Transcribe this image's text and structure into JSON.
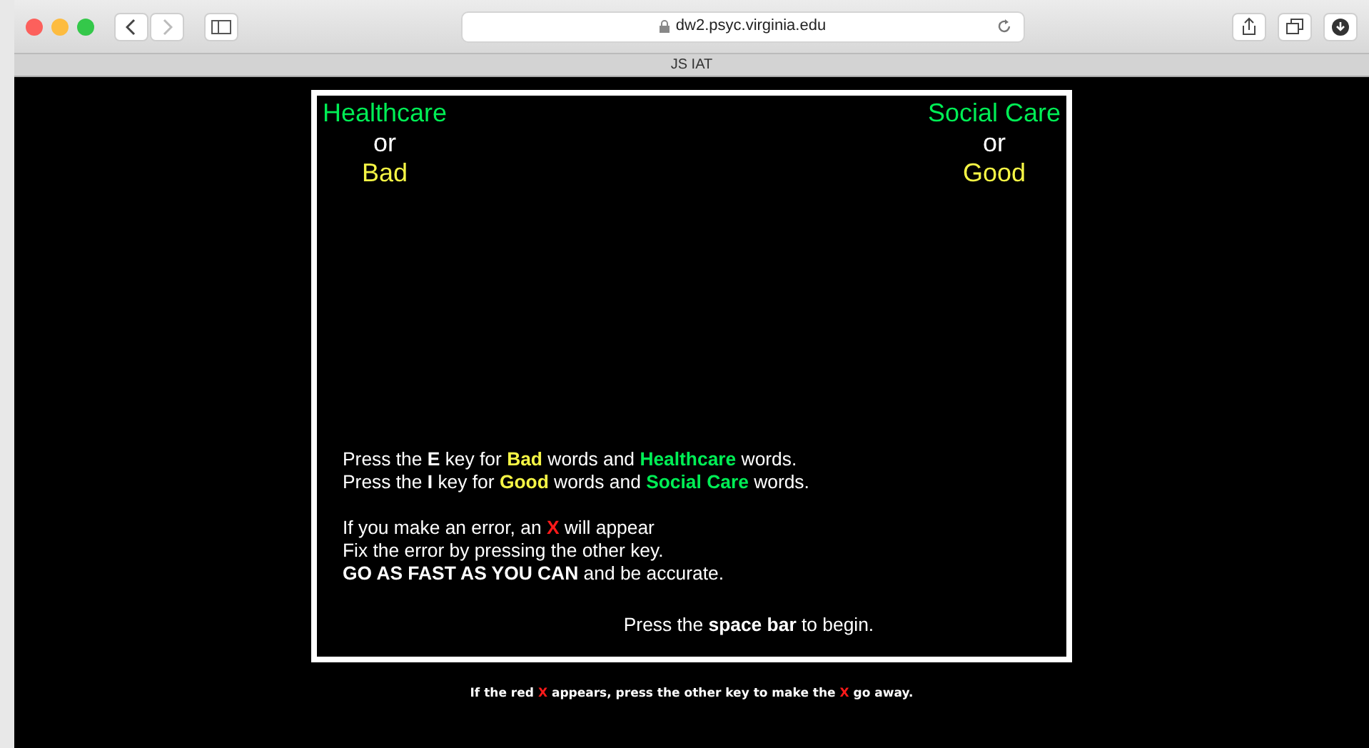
{
  "browser": {
    "url": "dw2.psyc.virginia.edu",
    "tab_title": "JS IAT"
  },
  "left_labels": [
    {
      "text": "Healthcare",
      "kind": "category"
    },
    {
      "text": "or",
      "kind": "connector"
    },
    {
      "text": "Bad",
      "kind": "attribute"
    }
  ],
  "right_labels": [
    {
      "text": "Social Care",
      "kind": "category"
    },
    {
      "text": "or",
      "kind": "connector"
    },
    {
      "text": "Good",
      "kind": "attribute"
    }
  ],
  "instruction_paragraphs": [
    [
      [
        {
          "text": "Press the ",
          "kind": "plain"
        },
        {
          "text": "E",
          "kind": "bold"
        },
        {
          "text": " key for ",
          "kind": "plain"
        },
        {
          "text": "Bad",
          "kind": "attribute"
        },
        {
          "text": " words and ",
          "kind": "plain"
        },
        {
          "text": "Healthcare",
          "kind": "category"
        },
        {
          "text": " words.",
          "kind": "plain"
        }
      ],
      [
        {
          "text": "Press the ",
          "kind": "plain"
        },
        {
          "text": "I",
          "kind": "bold"
        },
        {
          "text": " key for ",
          "kind": "plain"
        },
        {
          "text": "Good",
          "kind": "attribute"
        },
        {
          "text": " words and ",
          "kind": "plain"
        },
        {
          "text": "Social Care",
          "kind": "category"
        },
        {
          "text": " words.",
          "kind": "plain"
        }
      ]
    ],
    [
      [
        {
          "text": "If you make an error, an ",
          "kind": "plain"
        },
        {
          "text": "X",
          "kind": "error"
        },
        {
          "text": " will appear",
          "kind": "plain"
        }
      ],
      [
        {
          "text": "Fix the error by pressing the other key.",
          "kind": "plain"
        }
      ],
      [
        {
          "text": "GO AS FAST AS YOU CAN",
          "kind": "bold"
        },
        {
          "text": " and be accurate.",
          "kind": "plain"
        }
      ]
    ]
  ],
  "start_prompt": [
    {
      "text": "Press the ",
      "kind": "plain"
    },
    {
      "text": "space bar",
      "kind": "bold"
    },
    {
      "text": " to begin.",
      "kind": "plain"
    }
  ],
  "footer": [
    {
      "text": "If the red ",
      "kind": "plain"
    },
    {
      "text": "X",
      "kind": "error"
    },
    {
      "text": " appears, press the other key to make the ",
      "kind": "plain"
    },
    {
      "text": "X",
      "kind": "error"
    },
    {
      "text": " go away.",
      "kind": "plain"
    }
  ]
}
